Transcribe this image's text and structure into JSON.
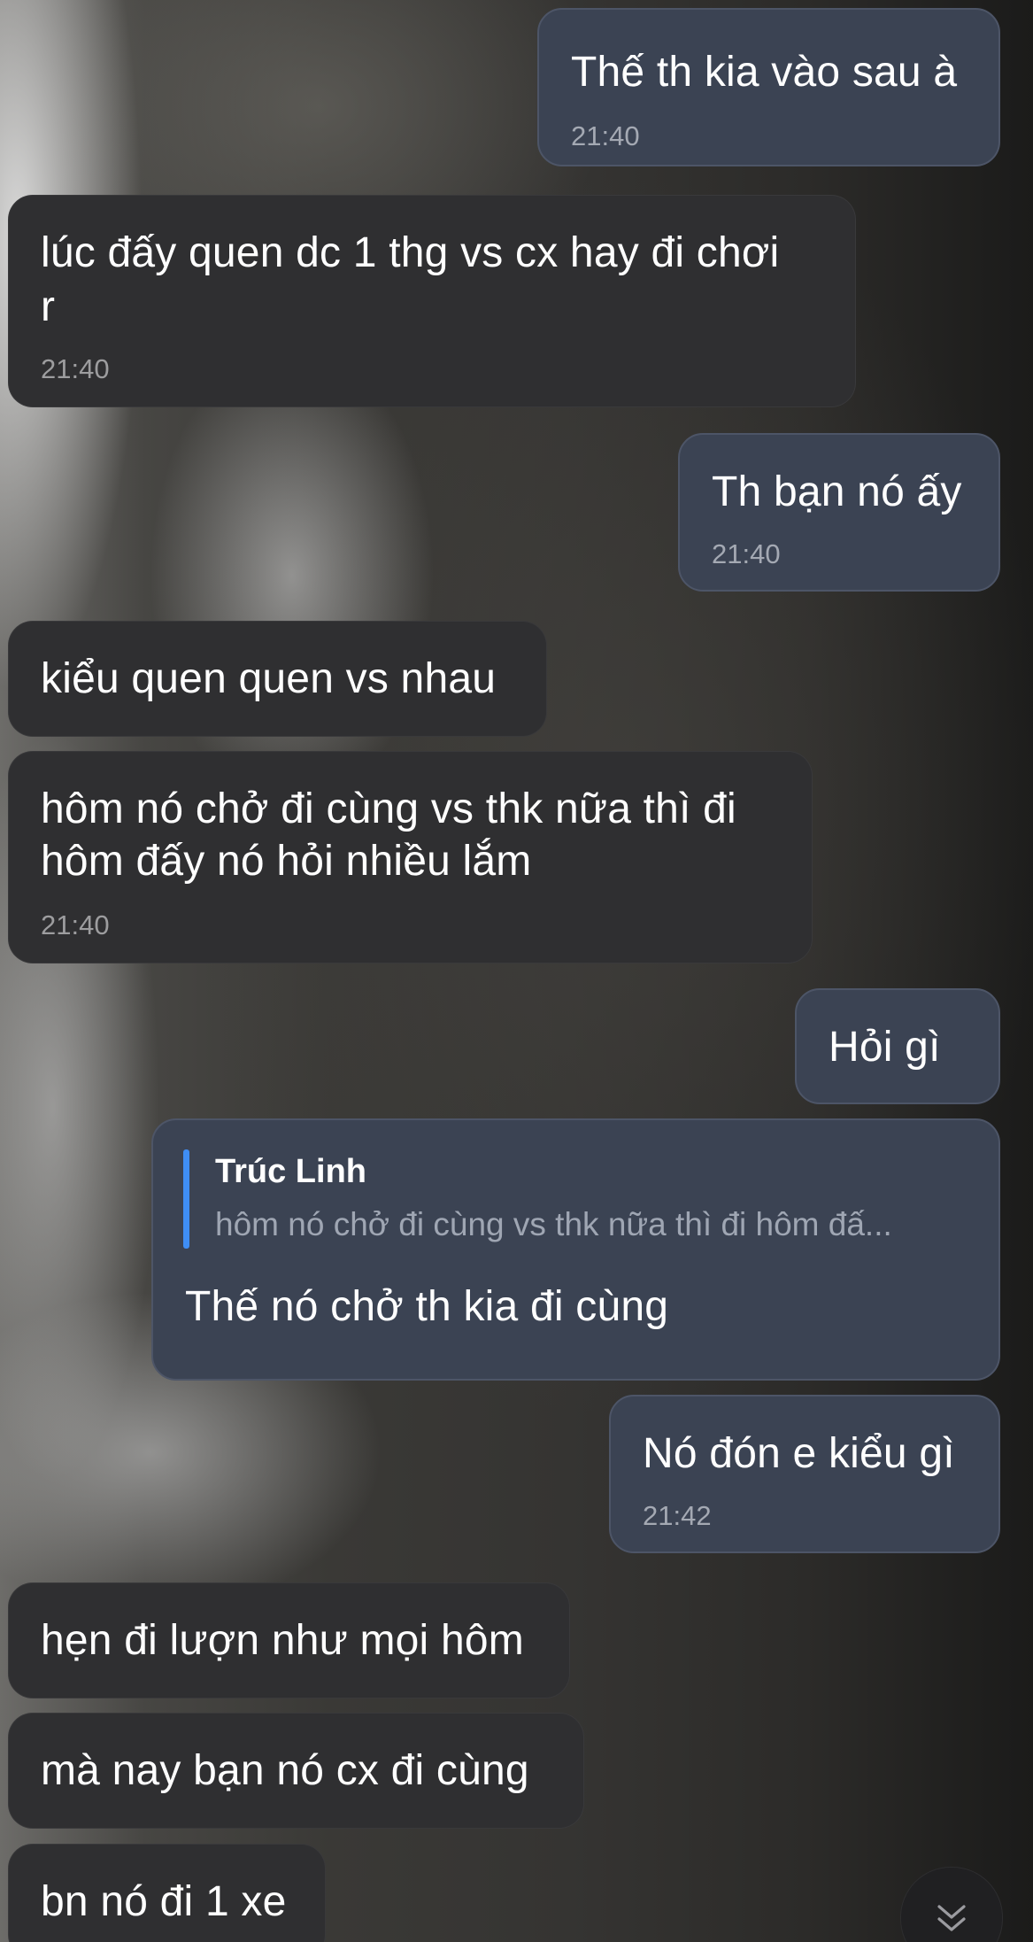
{
  "messages": [
    {
      "direction": "outgoing",
      "text": "Thế th kia vào sau à",
      "time": "21:40"
    },
    {
      "direction": "incoming",
      "text_lines": [
        "lúc đấy quen dc 1 thg vs cx hay đi chơi",
        "r"
      ],
      "time": "21:40"
    },
    {
      "direction": "outgoing",
      "text": "Th bạn nó ấy",
      "time": "21:40"
    },
    {
      "direction": "incoming",
      "text": "kiểu quen quen vs nhau"
    },
    {
      "direction": "incoming",
      "text_lines": [
        "hôm nó chở đi cùng vs thk nữa thì đi",
        "hôm đấy nó hỏi nhiều lắm"
      ],
      "time": "21:40"
    },
    {
      "direction": "outgoing",
      "text": "Hỏi gì"
    },
    {
      "direction": "outgoing",
      "reply_to": {
        "sender": "Trúc Linh",
        "snippet": "hôm nó chở đi cùng vs thk nữa thì đi hôm đấ..."
      },
      "text": "Thế nó chở th kia đi cùng"
    },
    {
      "direction": "outgoing",
      "text": "Nó đón e kiểu gì",
      "time": "21:42"
    },
    {
      "direction": "incoming",
      "text": "hẹn đi lượn như mọi hôm"
    },
    {
      "direction": "incoming",
      "text": "mà nay bạn nó cx đi cùng"
    },
    {
      "direction": "incoming",
      "text": "bn nó đi 1 xe"
    }
  ],
  "scroll_down_button": {
    "icon": "double-chevron-down-icon"
  },
  "colors": {
    "incoming_bubble": "#2f2f31",
    "outgoing_bubble": "#3b4353",
    "outgoing_border": "#4d5567",
    "reply_accent": "#3f8ef5",
    "timestamp": "#a4a9b3"
  }
}
